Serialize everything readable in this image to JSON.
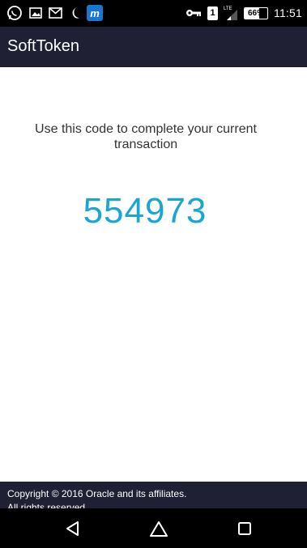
{
  "status_bar": {
    "icons_left": [
      "whatsapp-icon",
      "image-icon",
      "mail-icon",
      "moon-icon",
      "m-app-icon"
    ],
    "icons_right": [
      "key-icon",
      "sim-icon",
      "signal-icon",
      "battery-icon"
    ],
    "sim_number": "1",
    "network_label": "LTE",
    "battery_level": "66%",
    "battery_fraction": 0.66,
    "time": "11:51"
  },
  "app_bar": {
    "title": "SoftToken"
  },
  "main": {
    "instruction": "Use this code to complete your current transaction",
    "token_code": "554973"
  },
  "footer": {
    "copyright_line1": "Copyright © 2016 Oracle and its affiliates.",
    "copyright_line2": "All rights reserved."
  },
  "nav_bar": {
    "buttons": [
      "back-icon",
      "home-icon",
      "recents-icon"
    ]
  },
  "colors": {
    "app_bar_bg": "#1f2033",
    "token_color": "#1aa6d4",
    "status_bar_bg": "#000000",
    "m_app_icon": "#1976d2"
  }
}
